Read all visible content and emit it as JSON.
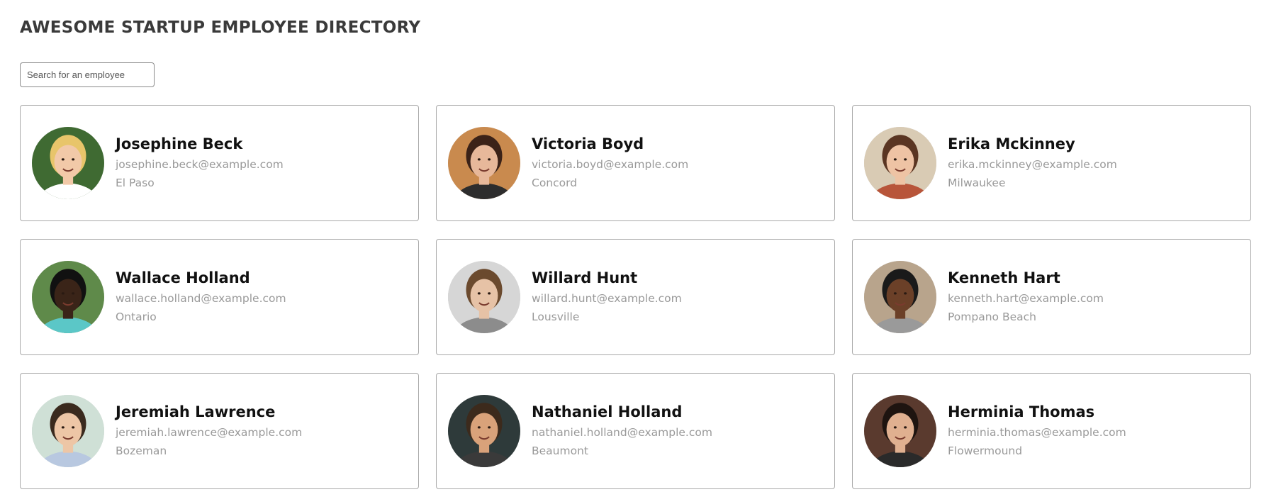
{
  "header": {
    "title": "AWESOME STARTUP EMPLOYEE DIRECTORY"
  },
  "search": {
    "placeholder": "Search for an employee",
    "value": ""
  },
  "employees": [
    {
      "name": "Josephine Beck",
      "email": "josephine.beck@example.com",
      "city": "El Paso",
      "skin": "#f2c9a8",
      "hair": "#e8c56a",
      "bg": "#3f6a32",
      "shirt": "#ffffff"
    },
    {
      "name": "Victoria Boyd",
      "email": "victoria.boyd@example.com",
      "city": "Concord",
      "skin": "#e7b89a",
      "hair": "#3b2218",
      "bg": "#c98a4e",
      "shirt": "#2d2d2d"
    },
    {
      "name": "Erika Mckinney",
      "email": "erika.mckinney@example.com",
      "city": "Milwaukee",
      "skin": "#eec3a4",
      "hair": "#5a3522",
      "bg": "#d9cbb4",
      "shirt": "#b8553a"
    },
    {
      "name": "Wallace Holland",
      "email": "wallace.holland@example.com",
      "city": "Ontario",
      "skin": "#3a2418",
      "hair": "#111111",
      "bg": "#5f8a4a",
      "shirt": "#5bc7c7"
    },
    {
      "name": "Willard Hunt",
      "email": "willard.hunt@example.com",
      "city": "Lousville",
      "skin": "#e6c2a6",
      "hair": "#6b4a2e",
      "bg": "#d6d6d6",
      "shirt": "#8c8c8c"
    },
    {
      "name": "Kenneth Hart",
      "email": "kenneth.hart@example.com",
      "city": "Pompano Beach",
      "skin": "#6b4028",
      "hair": "#1a1a1a",
      "bg": "#b8a48c",
      "shirt": "#9a9a9a"
    },
    {
      "name": "Jeremiah Lawrence",
      "email": "jeremiah.lawrence@example.com",
      "city": "Bozeman",
      "skin": "#edc6a6",
      "hair": "#3a2a1e",
      "bg": "#cfe0d6",
      "shirt": "#b8c8e0"
    },
    {
      "name": "Nathaniel Holland",
      "email": "nathaniel.holland@example.com",
      "city": "Beaumont",
      "skin": "#d9a27a",
      "hair": "#3c2a1c",
      "bg": "#2e3a3a",
      "shirt": "#3a3a3a"
    },
    {
      "name": "Herminia Thomas",
      "email": "herminia.thomas@example.com",
      "city": "Flowermound",
      "skin": "#e0b090",
      "hair": "#1e1410",
      "bg": "#5a3a2e",
      "shirt": "#2a2a2a"
    }
  ]
}
